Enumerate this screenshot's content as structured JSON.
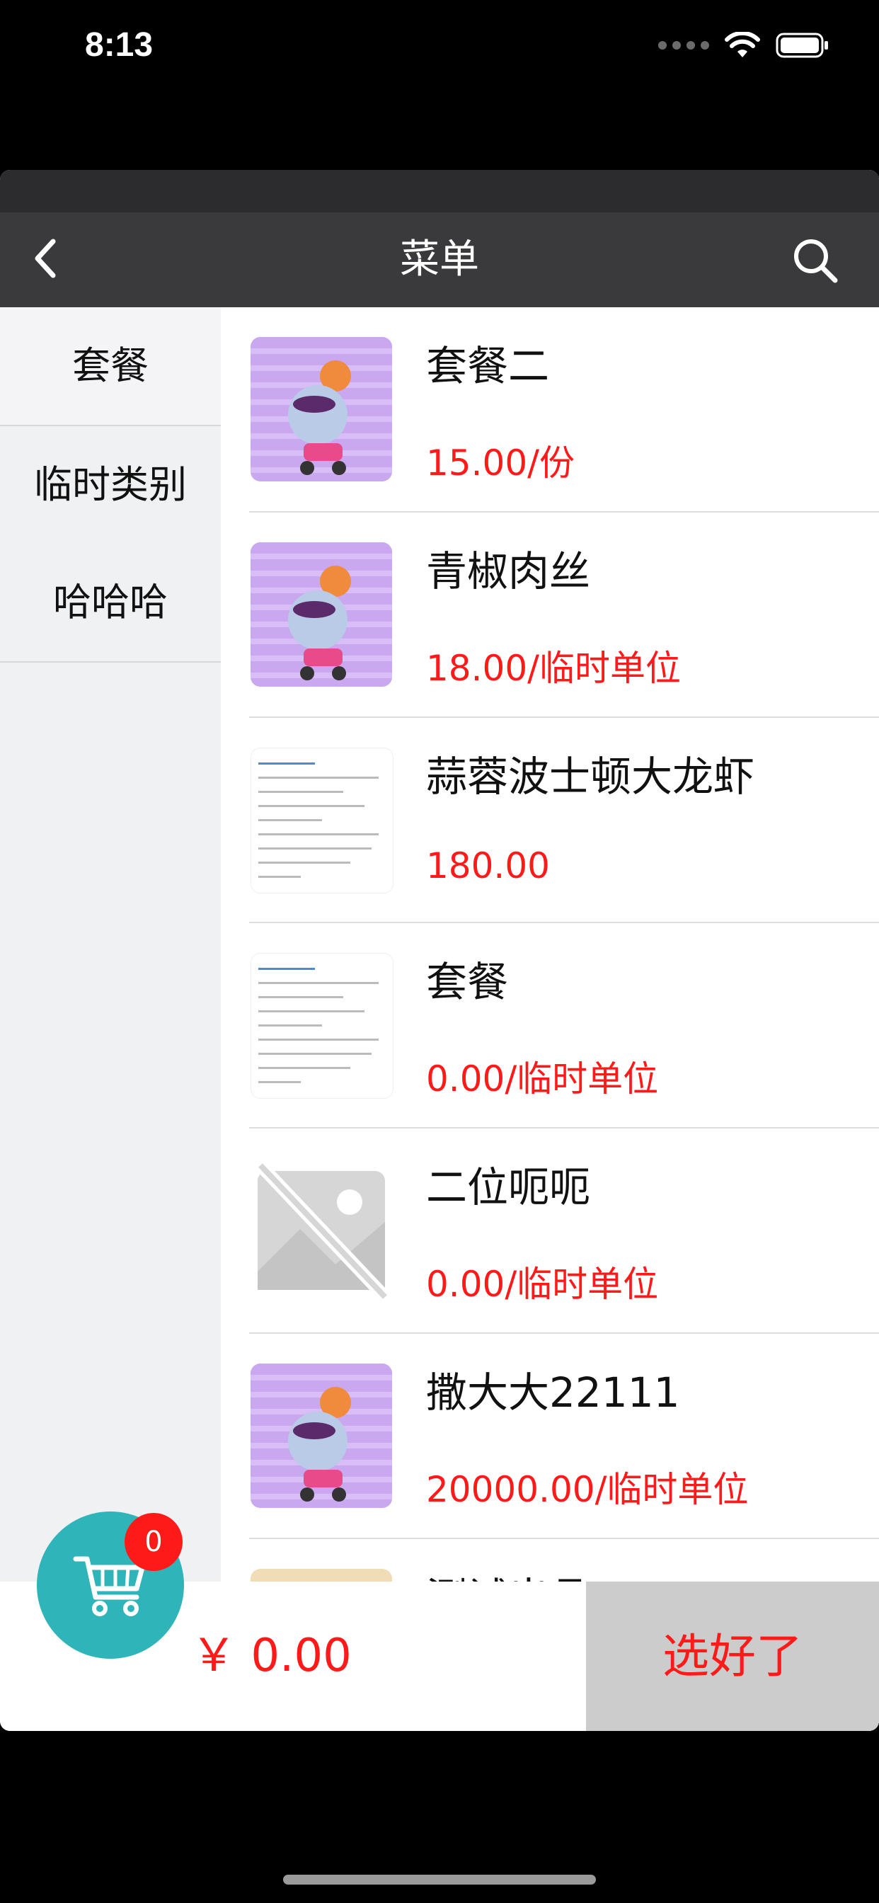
{
  "status_bar": {
    "time": "8:13"
  },
  "navbar": {
    "title": "菜单"
  },
  "categories": [
    "套餐",
    "临时类别",
    "哈哈哈"
  ],
  "products": [
    {
      "name": "套餐二",
      "price": "15.00/份",
      "image": "cartoon"
    },
    {
      "name": "青椒肉丝",
      "price": "18.00/临时单位",
      "image": "cartoon"
    },
    {
      "name": "蒜蓉波士顿大龙虾",
      "price": "180.00",
      "image": "document"
    },
    {
      "name": "套餐",
      "price": "0.00/临时单位",
      "image": "document"
    },
    {
      "name": "二位呃呃",
      "price": "0.00/临时单位",
      "image": "placeholder"
    },
    {
      "name": "撒大大22111",
      "price": "20000.00/临时单位",
      "image": "cartoon"
    },
    {
      "name": "测试出品",
      "price": "",
      "image": "food"
    }
  ],
  "cart": {
    "badge_count": "0",
    "total": "￥ 0.00",
    "checkout_label": "选好了"
  },
  "colors": {
    "accent_red": "#ff1a1a",
    "cart_teal": "#2fb5b9",
    "navbar": "#3a3a3c"
  }
}
